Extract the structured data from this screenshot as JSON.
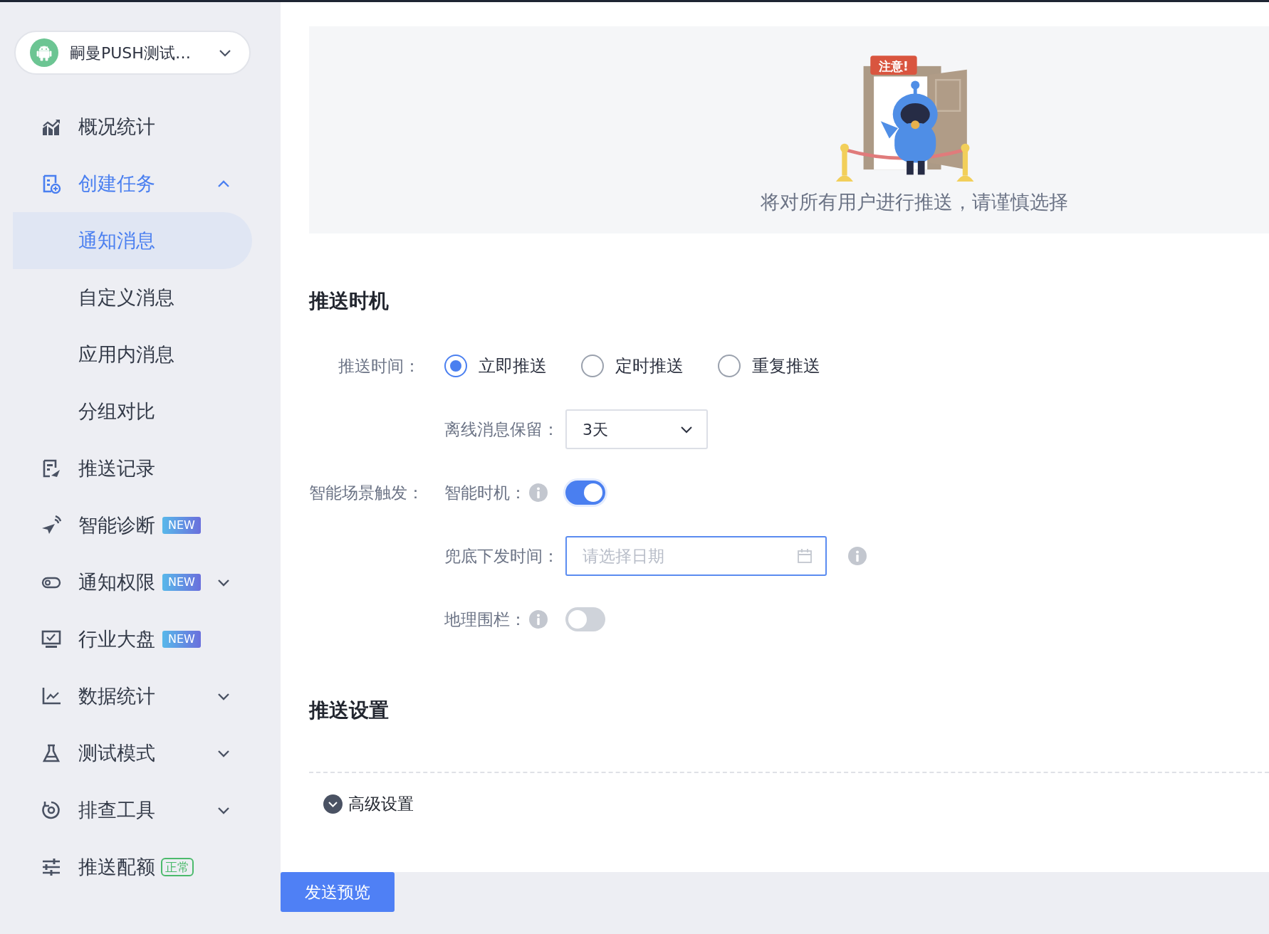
{
  "app_selector": {
    "name": "嗣曼PUSH测试…"
  },
  "sidebar": {
    "items": [
      {
        "label": "概况统计",
        "selected": false
      },
      {
        "label": "创建任务",
        "selected": true,
        "expanded": true,
        "children": [
          {
            "label": "通知消息",
            "selected": true
          },
          {
            "label": "自定义消息",
            "selected": false
          },
          {
            "label": "应用内消息",
            "selected": false
          },
          {
            "label": "分组对比",
            "selected": false
          }
        ]
      },
      {
        "label": "推送记录",
        "selected": false
      },
      {
        "label": "智能诊断",
        "selected": false,
        "badge": {
          "kind": "new",
          "text": "NEW"
        }
      },
      {
        "label": "通知权限",
        "selected": false,
        "expanded": false,
        "badge": {
          "kind": "new",
          "text": "NEW"
        }
      },
      {
        "label": "行业大盘",
        "selected": false,
        "badge": {
          "kind": "new",
          "text": "NEW"
        }
      },
      {
        "label": "数据统计",
        "selected": false,
        "expanded": false
      },
      {
        "label": "测试模式",
        "selected": false,
        "expanded": false
      },
      {
        "label": "排查工具",
        "selected": false,
        "expanded": false
      },
      {
        "label": "推送配额",
        "selected": false,
        "badge": {
          "kind": "status",
          "text": "正常"
        }
      }
    ]
  },
  "notice": {
    "sign": "注意!",
    "text": "将对所有用户进行推送，请谨慎选择"
  },
  "push_timing": {
    "title": "推送时机",
    "push_time": {
      "label": "推送时间：",
      "options": [
        {
          "label": "立即推送",
          "selected": true
        },
        {
          "label": "定时推送",
          "selected": false
        },
        {
          "label": "重复推送",
          "selected": false
        }
      ]
    },
    "offline_retention": {
      "label": "离线消息保留：",
      "value": "3天"
    },
    "smart_trigger": {
      "label": "智能场景触发：",
      "smart_timing": {
        "label": "智能时机：",
        "on": true
      },
      "fallback_time": {
        "label": "兜底下发时间：",
        "placeholder": "请选择日期",
        "focused": true
      },
      "geofence": {
        "label": "地理围栏：",
        "on": false
      }
    }
  },
  "push_settings": {
    "title": "推送设置",
    "advanced": {
      "label": "高级设置",
      "expanded": false
    }
  },
  "preview_button": "发送预览"
}
